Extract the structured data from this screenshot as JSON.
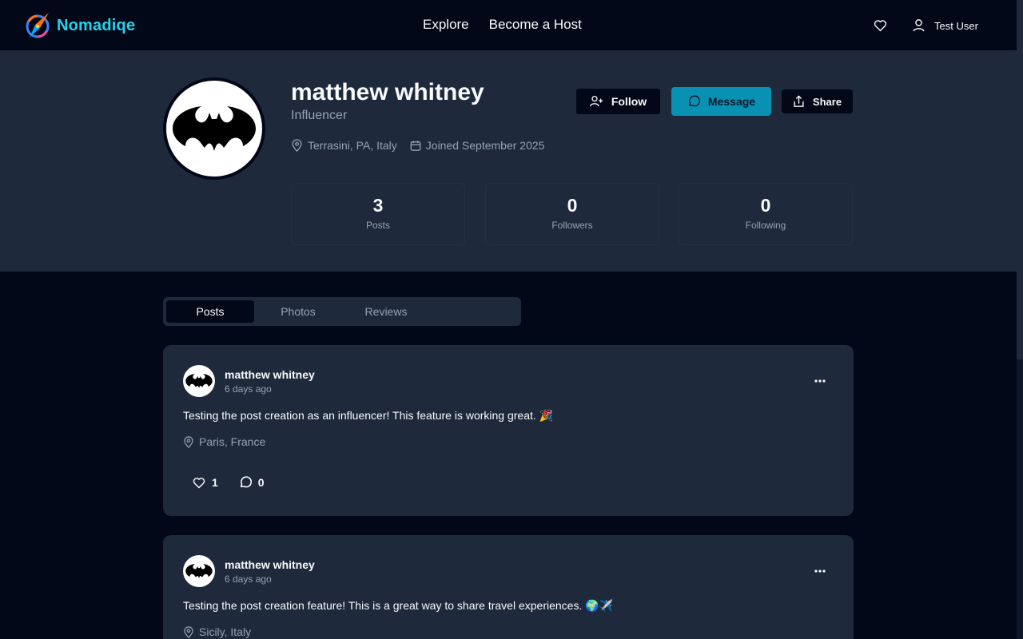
{
  "header": {
    "brand": "Nomadiqe",
    "nav": [
      "Explore",
      "Become a Host"
    ],
    "user_name": "Test User",
    "icons": [
      "compass-logo",
      "heart-icon",
      "user-icon"
    ]
  },
  "profile": {
    "name": "matthew whitney",
    "role": "Influencer",
    "location": "Terrasini, PA, Italy",
    "joined": "Joined September 2025",
    "avatar": "batman-logo",
    "buttons": {
      "follow": "Follow",
      "message": "Message",
      "share": "Share"
    },
    "stats": [
      {
        "value": "3",
        "label": "Posts"
      },
      {
        "value": "0",
        "label": "Followers"
      },
      {
        "value": "0",
        "label": "Following"
      }
    ]
  },
  "tabs": {
    "items": [
      "Posts",
      "Photos",
      "Reviews"
    ],
    "active": "Posts"
  },
  "posts": [
    {
      "author": "matthew whitney",
      "time": "6 days ago",
      "text": "Testing the post creation as an influencer! This feature is working great. 🎉",
      "location": "Paris, France",
      "likes": "1",
      "comments": "0"
    },
    {
      "author": "matthew whitney",
      "time": "6 days ago",
      "text": "Testing the post creation feature! This is a great way to share travel experiences. 🌍✈️",
      "location": "Sicily, Italy"
    }
  ],
  "colors": {
    "background": "#020817",
    "surface": "#1e293b",
    "accent": "#22d3ee",
    "message_button": "#0891b2",
    "muted_text": "#94a3b8"
  }
}
